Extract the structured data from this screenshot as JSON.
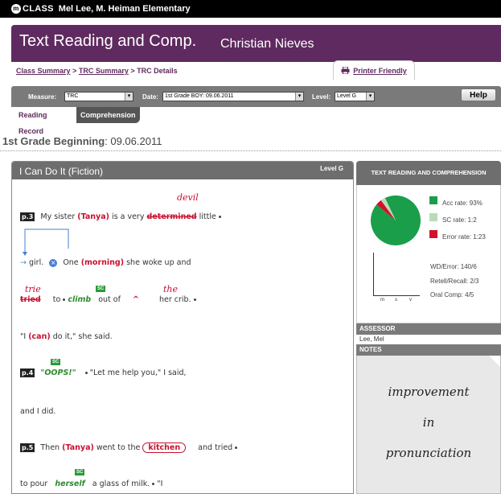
{
  "topbar": {
    "brand_mark": "m",
    "brand": "CLASS",
    "school": "Mel Lee, M. Heiman Elementary"
  },
  "header": {
    "title": "Text Reading and Comp.",
    "student": "Christian Nieves"
  },
  "breadcrumb": {
    "class_summary": "Class Summary",
    "trc_summary": "TRC Summary",
    "current": "TRC Details",
    "separator": ">"
  },
  "printer": {
    "label": "Printer Friendly",
    "icon": "printer-icon"
  },
  "toolbar": {
    "measure_label": "Measure:",
    "measure_value": "TRC",
    "date_label": "Date:",
    "date_value": "1st Grade BOY: 09.06.2011",
    "level_label": "Level:",
    "level_value": "Level G",
    "help_label": "Help"
  },
  "tabs": [
    {
      "label": "Reading Record",
      "selected": false
    },
    {
      "label": "Comprehension",
      "selected": true
    }
  ],
  "section": {
    "title_bold": "1st Grade Beginning",
    "title_rest": ": 09.06.2011"
  },
  "passage": {
    "title": "I Can Do It (Fiction)",
    "level": "Level G",
    "sc_badge": "SC",
    "line1": {
      "page": "p.3",
      "a": "My sister",
      "name": "(Tanya)",
      "b": "is a very",
      "strike": "determined",
      "c": "little",
      "hand": "devil"
    },
    "line2": {
      "a": "girl.",
      "b": "One",
      "word": "(morning)",
      "c": "she woke up and"
    },
    "line3": {
      "strike": "tried",
      "hand1": "trie",
      "b": "to",
      "sc_word": "climb",
      "c": "out of",
      "hand2": "the",
      "caret": "^",
      "d": "her crib."
    },
    "line4": {
      "a": "\"I",
      "word": "(can)",
      "b": "do it,\" she said."
    },
    "line5": {
      "page": "p.4",
      "sc_word": "\"OOPS!\"",
      "b": "\"Let me help you,\" I said,"
    },
    "line6": {
      "a": "and I did."
    },
    "line7": {
      "page": "p.5",
      "a": "Then",
      "name": "(Tanya)",
      "b": "went to the",
      "circled": "kitchen",
      "c": "and tried"
    },
    "line8": {
      "a": "to pour",
      "sc_word": "herself",
      "b": "a glass of milk.",
      "c": "\"I"
    }
  },
  "trc": {
    "heading": "TEXT READING AND COMPREHENSION",
    "accuracy_rate": "Acc rate: 93%",
    "sc_rate": "SC rate: 1:2",
    "error_rate": "Error rate: 1:23",
    "wd_error": "WD/Error: 140/6",
    "retell": "Retell/Recall: 2/3",
    "oral_comp": "Oral Comp: 4/5",
    "pie": {
      "accuracy_pct": 93,
      "sc_pct": 3,
      "error_pct": 4
    },
    "colors": {
      "accuracy": "#1a9e4a",
      "sc": "#b8dcb8",
      "error": "#d0122b"
    },
    "mini_axis": [
      "m",
      "s",
      "v"
    ]
  },
  "assessor": {
    "heading": "ASSESSOR",
    "name": "Lee, Mel"
  },
  "notes": {
    "heading": "NOTES",
    "line1": "improvement",
    "line2": "in",
    "line3": "pronunciation"
  }
}
